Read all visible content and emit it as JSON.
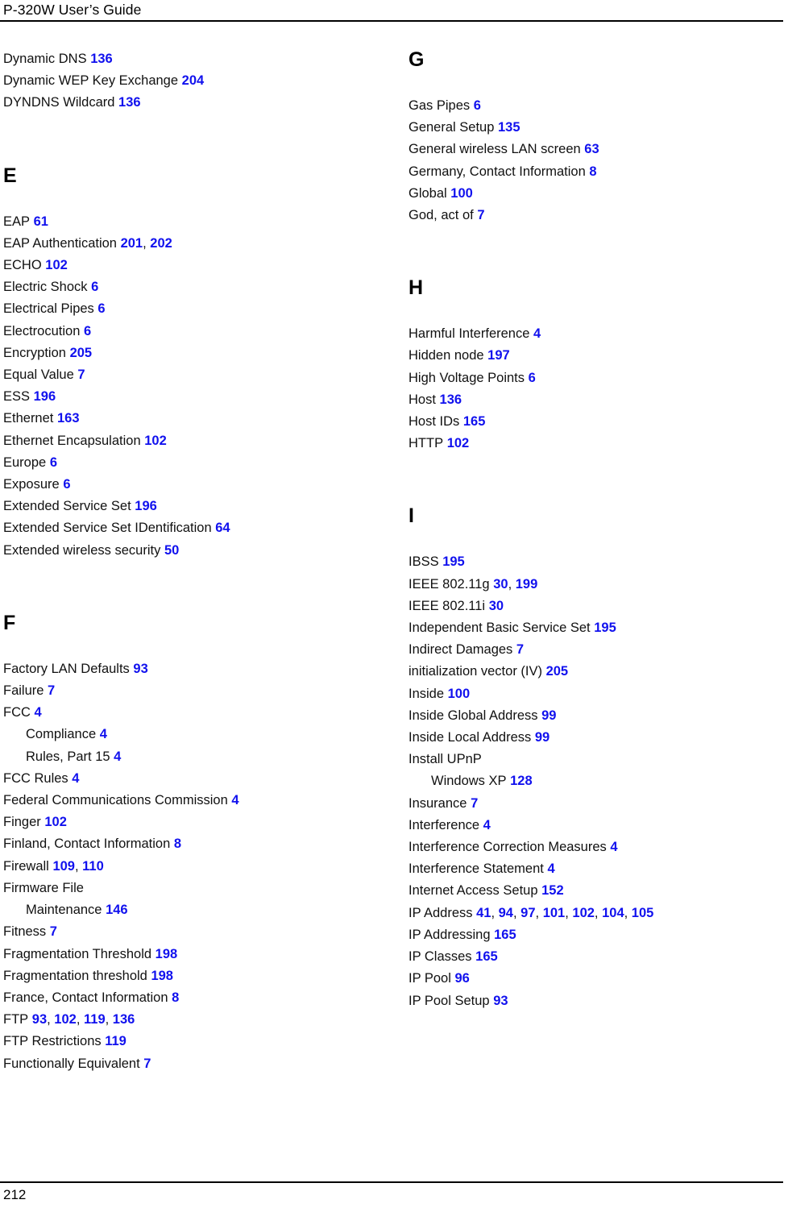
{
  "header": {
    "title": "P-320W User’s Guide"
  },
  "footer": {
    "page_number": "212"
  },
  "colors": {
    "page_number_link": "#1111ee",
    "body_text": "#111111",
    "rule": "#000000",
    "background": "#ffffff"
  },
  "columns": {
    "left": {
      "groups": [
        {
          "letter": "",
          "show_letter": false,
          "entries": [
            {
              "term": "Dynamic DNS",
              "sub": false,
              "pages": [
                "136"
              ]
            },
            {
              "term": "Dynamic WEP Key Exchange",
              "sub": false,
              "pages": [
                "204"
              ]
            },
            {
              "term": "DYNDNS Wildcard",
              "sub": false,
              "pages": [
                "136"
              ]
            }
          ]
        },
        {
          "letter": "E",
          "show_letter": true,
          "entries": [
            {
              "term": "EAP",
              "sub": false,
              "pages": [
                "61"
              ]
            },
            {
              "term": "EAP Authentication",
              "sub": false,
              "pages": [
                "201",
                "202"
              ]
            },
            {
              "term": "ECHO",
              "sub": false,
              "pages": [
                "102"
              ]
            },
            {
              "term": "Electric Shock",
              "sub": false,
              "pages": [
                "6"
              ]
            },
            {
              "term": "Electrical Pipes",
              "sub": false,
              "pages": [
                "6"
              ]
            },
            {
              "term": "Electrocution",
              "sub": false,
              "pages": [
                "6"
              ]
            },
            {
              "term": "Encryption",
              "sub": false,
              "pages": [
                "205"
              ]
            },
            {
              "term": "Equal Value",
              "sub": false,
              "pages": [
                "7"
              ]
            },
            {
              "term": "ESS",
              "sub": false,
              "pages": [
                "196"
              ]
            },
            {
              "term": "Ethernet",
              "sub": false,
              "pages": [
                "163"
              ]
            },
            {
              "term": "Ethernet Encapsulation",
              "sub": false,
              "pages": [
                "102"
              ]
            },
            {
              "term": "Europe",
              "sub": false,
              "pages": [
                "6"
              ]
            },
            {
              "term": "Exposure",
              "sub": false,
              "pages": [
                "6"
              ]
            },
            {
              "term": "Extended Service Set",
              "sub": false,
              "pages": [
                "196"
              ]
            },
            {
              "term": "Extended Service Set IDentification",
              "sub": false,
              "pages": [
                "64"
              ]
            },
            {
              "term": "Extended wireless security",
              "sub": false,
              "pages": [
                "50"
              ]
            }
          ]
        },
        {
          "letter": "F",
          "show_letter": true,
          "entries": [
            {
              "term": "Factory LAN Defaults",
              "sub": false,
              "pages": [
                "93"
              ]
            },
            {
              "term": "Failure",
              "sub": false,
              "pages": [
                "7"
              ]
            },
            {
              "term": "FCC",
              "sub": false,
              "pages": [
                "4"
              ]
            },
            {
              "term": "Compliance",
              "sub": true,
              "pages": [
                "4"
              ]
            },
            {
              "term": "Rules, Part 15",
              "sub": true,
              "pages": [
                "4"
              ]
            },
            {
              "term": "FCC Rules",
              "sub": false,
              "pages": [
                "4"
              ]
            },
            {
              "term": "Federal Communications Commission",
              "sub": false,
              "pages": [
                "4"
              ]
            },
            {
              "term": "Finger",
              "sub": false,
              "pages": [
                "102"
              ]
            },
            {
              "term": "Finland, Contact Information",
              "sub": false,
              "pages": [
                "8"
              ]
            },
            {
              "term": "Firewall",
              "sub": false,
              "pages": [
                "109",
                "110"
              ]
            },
            {
              "term": "Firmware File",
              "sub": false,
              "pages": []
            },
            {
              "term": "Maintenance",
              "sub": true,
              "pages": [
                "146"
              ]
            },
            {
              "term": "Fitness",
              "sub": false,
              "pages": [
                "7"
              ]
            },
            {
              "term": "Fragmentation Threshold",
              "sub": false,
              "pages": [
                "198"
              ]
            },
            {
              "term": "Fragmentation threshold",
              "sub": false,
              "pages": [
                "198"
              ]
            },
            {
              "term": "France, Contact Information",
              "sub": false,
              "pages": [
                "8"
              ]
            },
            {
              "term": "FTP",
              "sub": false,
              "pages": [
                "93",
                "102",
                "119",
                "136"
              ]
            },
            {
              "term": "FTP Restrictions",
              "sub": false,
              "pages": [
                "119"
              ]
            },
            {
              "term": "Functionally Equivalent",
              "sub": false,
              "pages": [
                "7"
              ]
            }
          ]
        }
      ]
    },
    "right": {
      "groups": [
        {
          "letter": "G",
          "show_letter": true,
          "entries": [
            {
              "term": "Gas Pipes",
              "sub": false,
              "pages": [
                "6"
              ]
            },
            {
              "term": "General Setup",
              "sub": false,
              "pages": [
                "135"
              ]
            },
            {
              "term": "General wireless LAN screen",
              "sub": false,
              "pages": [
                "63"
              ]
            },
            {
              "term": "Germany, Contact Information",
              "sub": false,
              "pages": [
                "8"
              ]
            },
            {
              "term": "Global",
              "sub": false,
              "pages": [
                "100"
              ]
            },
            {
              "term": "God, act of",
              "sub": false,
              "pages": [
                "7"
              ]
            }
          ]
        },
        {
          "letter": "H",
          "show_letter": true,
          "entries": [
            {
              "term": "Harmful Interference",
              "sub": false,
              "pages": [
                "4"
              ]
            },
            {
              "term": "Hidden node",
              "sub": false,
              "pages": [
                "197"
              ]
            },
            {
              "term": "High Voltage Points",
              "sub": false,
              "pages": [
                "6"
              ]
            },
            {
              "term": "Host",
              "sub": false,
              "pages": [
                "136"
              ]
            },
            {
              "term": "Host IDs",
              "sub": false,
              "pages": [
                "165"
              ]
            },
            {
              "term": "HTTP",
              "sub": false,
              "pages": [
                "102"
              ]
            }
          ]
        },
        {
          "letter": "I",
          "show_letter": true,
          "entries": [
            {
              "term": "IBSS",
              "sub": false,
              "pages": [
                "195"
              ]
            },
            {
              "term": "IEEE 802.11g",
              "sub": false,
              "pages": [
                "30",
                "199"
              ]
            },
            {
              "term": "IEEE 802.11i",
              "sub": false,
              "pages": [
                "30"
              ]
            },
            {
              "term": "Independent Basic Service Set",
              "sub": false,
              "pages": [
                "195"
              ]
            },
            {
              "term": "Indirect Damages",
              "sub": false,
              "pages": [
                "7"
              ]
            },
            {
              "term": "initialization vector (IV)",
              "sub": false,
              "pages": [
                "205"
              ]
            },
            {
              "term": "Inside",
              "sub": false,
              "pages": [
                "100"
              ]
            },
            {
              "term": "Inside Global Address",
              "sub": false,
              "pages": [
                "99"
              ]
            },
            {
              "term": "Inside Local Address",
              "sub": false,
              "pages": [
                "99"
              ]
            },
            {
              "term": "Install UPnP",
              "sub": false,
              "pages": []
            },
            {
              "term": "Windows XP",
              "sub": true,
              "pages": [
                "128"
              ]
            },
            {
              "term": "Insurance",
              "sub": false,
              "pages": [
                "7"
              ]
            },
            {
              "term": "Interference",
              "sub": false,
              "pages": [
                "4"
              ]
            },
            {
              "term": "Interference Correction Measures",
              "sub": false,
              "pages": [
                "4"
              ]
            },
            {
              "term": "Interference Statement",
              "sub": false,
              "pages": [
                "4"
              ]
            },
            {
              "term": "Internet Access Setup",
              "sub": false,
              "pages": [
                "152"
              ]
            },
            {
              "term": "IP Address",
              "sub": false,
              "pages": [
                "41",
                "94",
                "97",
                "101",
                "102",
                "104",
                "105"
              ]
            },
            {
              "term": "IP Addressing",
              "sub": false,
              "pages": [
                "165"
              ]
            },
            {
              "term": "IP Classes",
              "sub": false,
              "pages": [
                "165"
              ]
            },
            {
              "term": "IP Pool",
              "sub": false,
              "pages": [
                "96"
              ]
            },
            {
              "term": "IP Pool Setup",
              "sub": false,
              "pages": [
                "93"
              ]
            }
          ]
        }
      ]
    }
  }
}
